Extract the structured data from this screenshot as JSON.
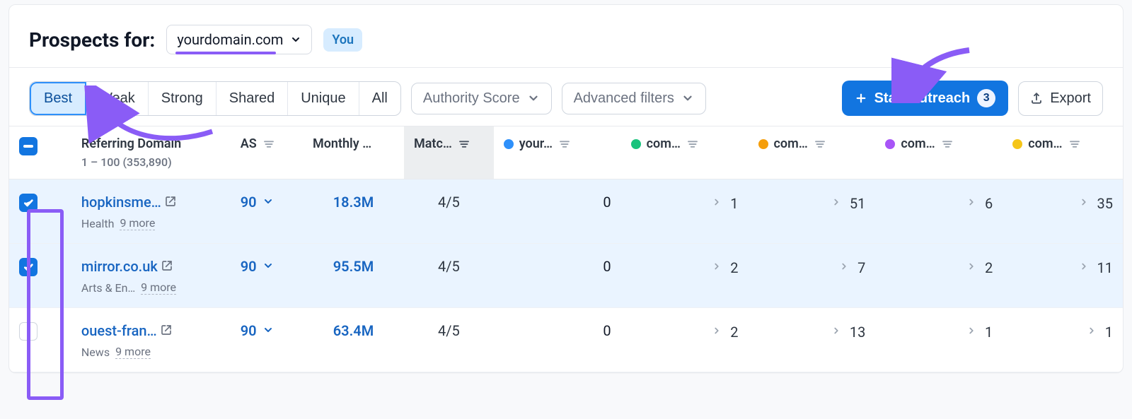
{
  "colors": {
    "primary": "#1275e0",
    "accentPurple": "#8a5cf6",
    "blue": "#2e90fa",
    "green": "#19c37d",
    "orange": "#f59e0b",
    "purple": "#a855f7",
    "amber": "#f5c518"
  },
  "header": {
    "title": "Prospects for:",
    "domain": "yourdomain.com",
    "you_badge": "You"
  },
  "filters": {
    "segments": [
      {
        "id": "best",
        "label": "Best",
        "active": true
      },
      {
        "id": "weak",
        "label": "Weak",
        "active": false
      },
      {
        "id": "strong",
        "label": "Strong",
        "active": false
      },
      {
        "id": "shared",
        "label": "Shared",
        "active": false
      },
      {
        "id": "unique",
        "label": "Unique",
        "active": false
      },
      {
        "id": "all",
        "label": "All",
        "active": false
      }
    ],
    "authority_score": "Authority Score",
    "advanced": "Advanced filters"
  },
  "actions": {
    "start_outreach": "Start outreach",
    "start_count": "3",
    "export": "Export"
  },
  "columns": {
    "referring_domain": "Referring Domain",
    "range_text": "1 – 100 (353,890)",
    "as": "AS",
    "monthly": "Monthly …",
    "match": "Matc…",
    "competitors": [
      {
        "dotClass": "blue",
        "label": "your…"
      },
      {
        "dotClass": "green",
        "label": "com…"
      },
      {
        "dotClass": "orange",
        "label": "com…"
      },
      {
        "dotClass": "purple",
        "label": "com…"
      },
      {
        "dotClass": "amber",
        "label": "com…"
      }
    ]
  },
  "rows": [
    {
      "selected": true,
      "domain": "hopkinsme…",
      "category": "Health",
      "more": "9 more",
      "as": "90",
      "monthly": "18.3M",
      "match": "4/5",
      "vals": [
        "0",
        "1",
        "51",
        "6",
        "35"
      ]
    },
    {
      "selected": true,
      "domain": "mirror.co.uk",
      "category": "Arts & En…",
      "more": "9 more",
      "as": "90",
      "monthly": "95.5M",
      "match": "4/5",
      "vals": [
        "0",
        "2",
        "7",
        "2",
        "11"
      ]
    },
    {
      "selected": false,
      "domain": "ouest-fran…",
      "category": "News",
      "more": "9 more",
      "as": "90",
      "monthly": "63.4M",
      "match": "4/5",
      "vals": [
        "0",
        "2",
        "13",
        "1",
        "1"
      ]
    }
  ]
}
